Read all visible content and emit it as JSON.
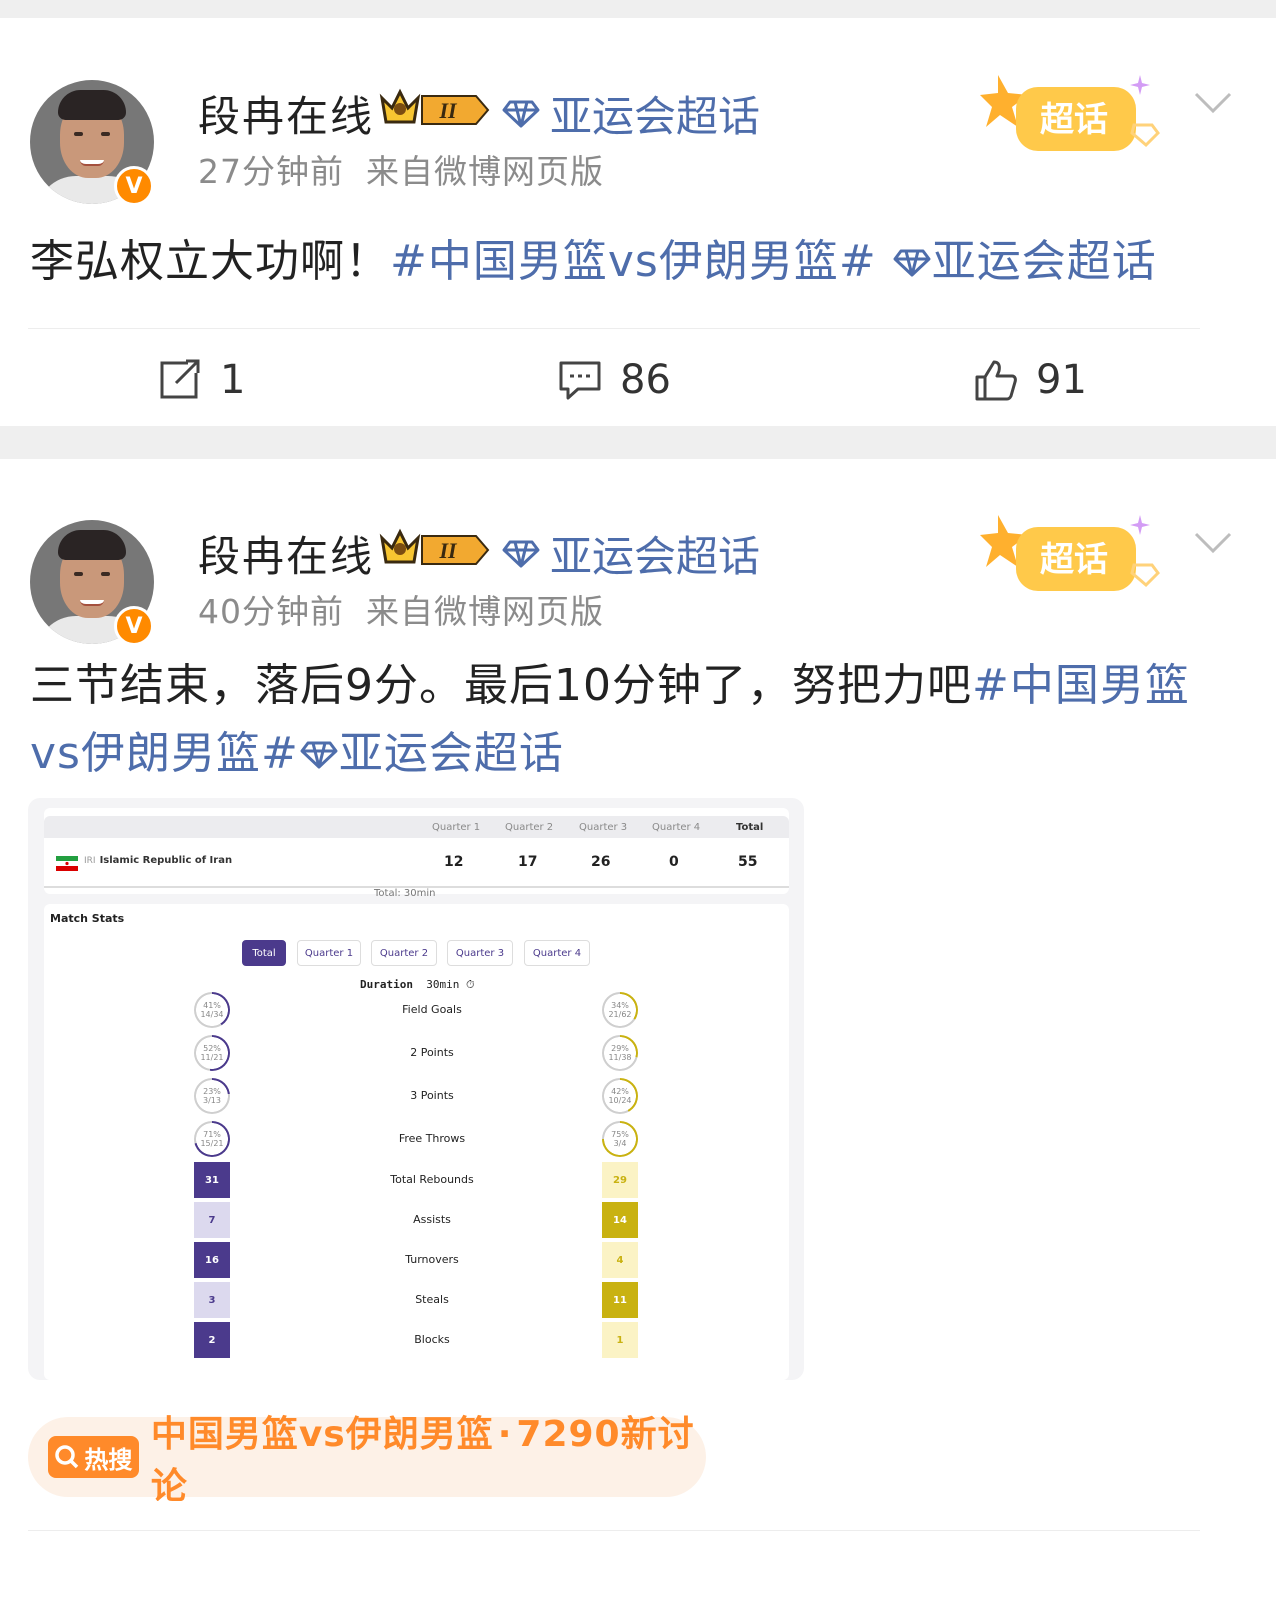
{
  "posts": [
    {
      "author": "段冉在线",
      "level_badge": "II",
      "topic_label": "亚运会超话",
      "time": "27分钟前",
      "source": "来自微博网页版",
      "chaohua_badge": "超话",
      "content_text": "李弘权立大功啊！",
      "content_hashtag": "#中国男篮vs伊朗男篮#",
      "content_topic": "亚运会超话",
      "reposts": "1",
      "comments": "86",
      "likes": "91"
    },
    {
      "author": "段冉在线",
      "level_badge": "II",
      "topic_label": "亚运会超话",
      "time": "40分钟前",
      "source": "来自微博网页版",
      "chaohua_badge": "超话",
      "content_text": "三节结束，落后9分。最后10分钟了，努把力吧",
      "content_hashtag": "#中国男篮vs伊朗男篮#",
      "content_topic": "亚运会超话"
    }
  ],
  "scoreboard": {
    "columns": [
      "Quarter 1",
      "Quarter 2",
      "Quarter 3",
      "Quarter 4",
      "Total"
    ],
    "team_code": "IRI",
    "team_name": "Islamic Republic of Iran",
    "scores": [
      "12",
      "17",
      "26",
      "0",
      "55"
    ],
    "total_time": "Total: 30min"
  },
  "match_stats": {
    "title": "Match Stats",
    "tabs": [
      "Total",
      "Quarter 1",
      "Quarter 2",
      "Quarter 3",
      "Quarter 4"
    ],
    "active_tab": "Total",
    "duration_label": "Duration",
    "duration_value": "30min",
    "percent_rows": [
      {
        "label": "Field Goals",
        "left_pct": "41%",
        "left_frac": "14/34",
        "right_pct": "34%",
        "right_frac": "21/62"
      },
      {
        "label": "2 Points",
        "left_pct": "52%",
        "left_frac": "11/21",
        "right_pct": "29%",
        "right_frac": "11/38"
      },
      {
        "label": "3 Points",
        "left_pct": "23%",
        "left_frac": "3/13",
        "right_pct": "42%",
        "right_frac": "10/24"
      },
      {
        "label": "Free Throws",
        "left_pct": "71%",
        "left_frac": "15/21",
        "right_pct": "75%",
        "right_frac": "3/4"
      }
    ],
    "count_rows": [
      {
        "label": "Total Rebounds",
        "left": "31",
        "right": "29",
        "left_dark": true,
        "right_dark": false
      },
      {
        "label": "Assists",
        "left": "7",
        "right": "14",
        "left_dark": false,
        "right_dark": true
      },
      {
        "label": "Turnovers",
        "left": "16",
        "right": "4",
        "left_dark": true,
        "right_dark": false
      },
      {
        "label": "Steals",
        "left": "3",
        "right": "11",
        "left_dark": false,
        "right_dark": true
      },
      {
        "label": "Blocks",
        "left": "2",
        "right": "1",
        "left_dark": true,
        "right_dark": false
      }
    ],
    "colors": {
      "purple": "#4b3a8c",
      "purple_light": "#dcd9ee",
      "gold": "#c9b211",
      "gold_light": "#fbf3c5"
    }
  },
  "hot_search": {
    "badge": "热搜",
    "topic": "中国男篮vs伊朗男篮",
    "separator": "·",
    "count_text": "7290新讨论"
  },
  "colors": {
    "link_blue": "#4e6dab",
    "orange": "#ff8a2a",
    "gray_text": "#8b8b8b"
  }
}
